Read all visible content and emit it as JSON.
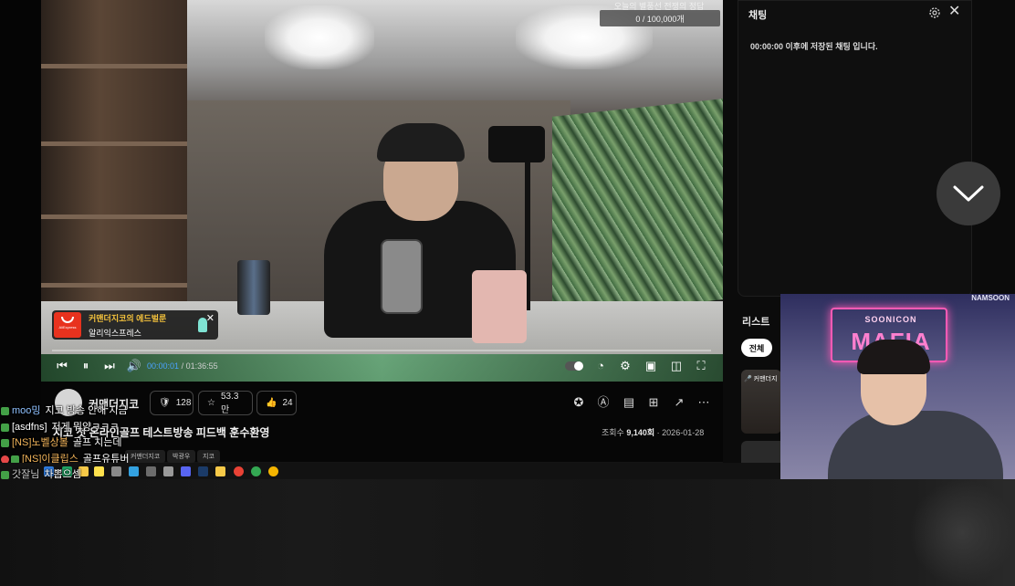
{
  "player": {
    "counter_top": "오늘의 별풍선 전쟁의 정답",
    "counter": "0 / 100,000개",
    "ad_title": "커맨더지코의 에드벌룬",
    "ad_subtitle": "알리익스프레스",
    "ad_brand": "AliExpress",
    "time_current": "00:00:01",
    "time_total": "01:36:55",
    "progress": 0.0
  },
  "chat_panel": {
    "title": "채팅",
    "note": "00:00:00 이후에 저장된 채팅 입니다."
  },
  "list": {
    "title": "리스트",
    "tab_all": "전체",
    "thumb_label": "커맨더지"
  },
  "pip": {
    "logo_small": "SOONICON",
    "logo_big": "MAFIA",
    "corner": "NAMSOON"
  },
  "info": {
    "channel": "커맨더지코",
    "badge_count": "128",
    "favorites": "53.3만",
    "likes": "24",
    "title": "지코 첫 온라인골프 테스트방송 피드백 훈수환영",
    "views_label": "조회수",
    "views": "9,140회",
    "date": "2026-01-28",
    "tags": [
      "커맨더지코",
      "박광우",
      "지코"
    ]
  },
  "chat_overlay": [
    {
      "nick": "moo밍",
      "msg": "지코 방송 안해 지금"
    },
    {
      "nick": "[asdfns]",
      "msg": "저게 뭐양ㅋㅋㅋ"
    },
    {
      "nick": "[NS]노벨상볼",
      "msg": "골프 치는데"
    },
    {
      "nick": "[NS]이클립스",
      "msg": "골프유튜버"
    },
    {
      "nick": "갓잘님",
      "msg": "차뽑으셈"
    }
  ],
  "colors": {
    "accent_blue": "#4aa3ff",
    "ad_yellow": "#f4c23c",
    "aliexpress_red": "#e8321e",
    "mafia_pink": "#ff80cf"
  }
}
